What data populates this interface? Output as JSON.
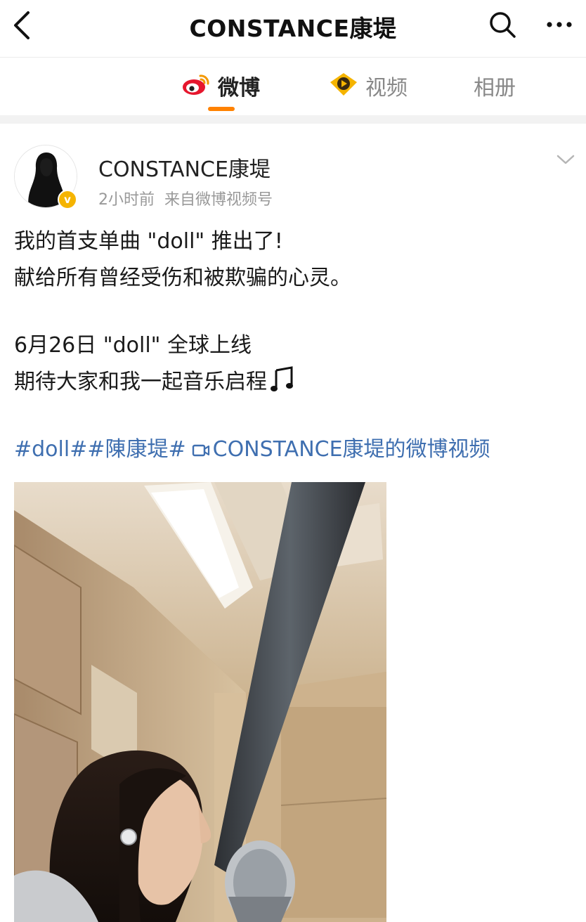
{
  "header": {
    "title": "CONSTANCE康堤",
    "back_icon": "chevron-left-icon",
    "search_icon": "search-icon",
    "more_icon": "more-horizontal-icon"
  },
  "tabs": [
    {
      "label": "微博",
      "icon": "weibo-logo-icon",
      "active": true
    },
    {
      "label": "视频",
      "icon": "video-play-icon",
      "active": false
    },
    {
      "label": "相册",
      "icon": "",
      "active": false
    }
  ],
  "colors": {
    "accent": "#ff8200",
    "link": "#3f6fb0",
    "verified": "#f5b400",
    "muted": "#999999"
  },
  "post": {
    "author": "CONSTANCE康堤",
    "verified": true,
    "time": "2小时前",
    "source": "来自微博视频号",
    "lines": [
      "我的首支单曲 \"doll\" 推出了!",
      "献给所有曾经受伤和被欺骗的心灵。",
      "6月26日 \"doll\" 全球上线",
      "期待大家和我一起音乐启程"
    ],
    "emoji": "music-note-icon",
    "topics": [
      "#doll#",
      "#陳康堤#"
    ],
    "video_link": "CONSTANCE康堤的微博视频"
  }
}
